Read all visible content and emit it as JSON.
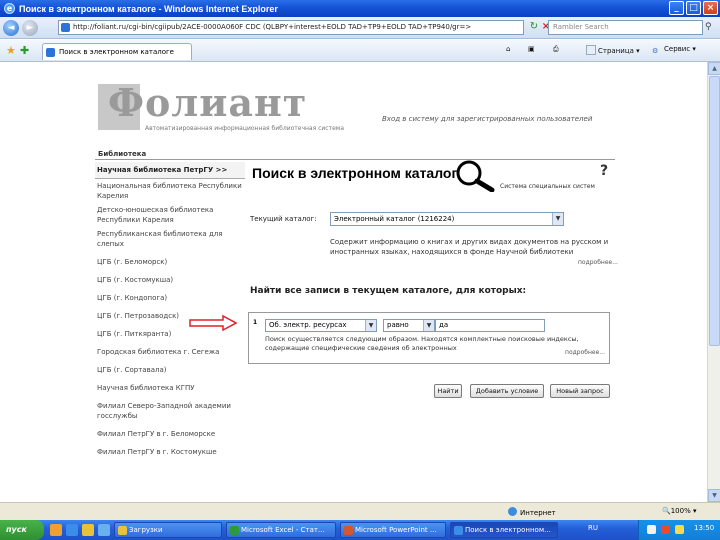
{
  "window": {
    "title": "Поиск в электронном каталоге - Windows Internet Explorer"
  },
  "address": {
    "url": "http://foliant.ru/cgi-bin/cgiipub/2ACE-0000A060F CDC (QLBPY+interest+EOLD TAD+TP9+EOLD TAD+TP940/gr=>",
    "search_placeholder": "Rambler Search"
  },
  "tab": {
    "label": "Поиск в электронном каталоге"
  },
  "commands": {
    "page": "Страница",
    "tools": "Сервис"
  },
  "site": {
    "logo": "Фолиант",
    "logo_sub": "Автоматизированная информационная библиотечная система",
    "login_link": "Вход в систему для зарегистрированных пользователей",
    "section": "Библиотека"
  },
  "sidebar": {
    "current": "Научная библиотека ПетрГУ >>",
    "items": [
      "Национальная библиотека Республики Карелия",
      "Детско-юношеская библиотека Республики Карелия",
      "Республиканская библиотека для слепых",
      "ЦГБ (г. Беломорск)",
      "ЦГБ (г. Костомукша)",
      "ЦГБ (г. Кондопога)",
      "ЦГБ (г. Петрозаводск)",
      "ЦГБ (г. Питкяранта)",
      "Городская библиотека г. Сегежа",
      "ЦГБ (г. Сортавала)",
      "Научная библиотека КГПУ",
      "Филиал Северо-Западной академии госслужбы",
      "Филиал ПетрГУ в г. Беломорске",
      "Филиал ПетрГУ в г. Костомукше"
    ]
  },
  "main": {
    "title": "Поиск в электронном каталоге",
    "help": "?",
    "special_link": "Система специальных систем",
    "catalog_label": "Текущий каталог:",
    "catalog_value": "Электронный каталог (1216224)",
    "catalog_desc": "Содержит информацию о книгах и других видах документов на русском и иностранных языках, находящихся в фонде Научной библиотеки",
    "more": "подробнее...",
    "find_title": "Найти все записи в текущем каталоге, для которых:",
    "criteria": {
      "number": "1",
      "field": "Об. электр. ресурсах",
      "operator": "равно",
      "term": "да",
      "desc": "Поиск осуществляется следующим образом. Находятся комплектные поисковые индексы, содержащие специфические сведения об электронных"
    },
    "buttons": {
      "search": "Найти",
      "add": "Добавить условие",
      "new": "Новый запрос"
    }
  },
  "status": {
    "zone": "Интернет",
    "zoom": "100%"
  },
  "taskbar": {
    "start": "пуск",
    "tasks": [
      "Загрузки",
      "Microsoft Excel - Стат...",
      "Microsoft PowerPoint ...",
      "Поиск в электронном..."
    ],
    "lang": "RU",
    "clock": "13:50"
  },
  "colors": {
    "titlebar": "#1553d6",
    "red_arrow": "#e0202a"
  }
}
